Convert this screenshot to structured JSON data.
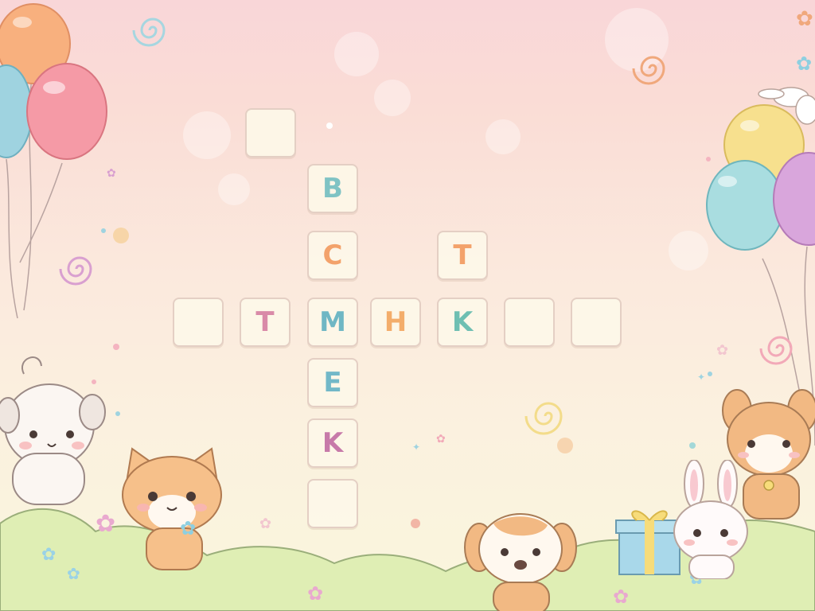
{
  "puzzle": {
    "tiles": [
      {
        "id": "r1c3",
        "letter": "",
        "color": ""
      },
      {
        "id": "r2c3",
        "letter": "B",
        "color": "#7fc3c4"
      },
      {
        "id": "r3c3",
        "letter": "C",
        "color": "#f3a26b"
      },
      {
        "id": "r3c5",
        "letter": "T",
        "color": "#f3a26b"
      },
      {
        "id": "r4c1",
        "letter": "",
        "color": ""
      },
      {
        "id": "r4c2",
        "letter": "T",
        "color": "#d98aa8"
      },
      {
        "id": "r4c3",
        "letter": "M",
        "color": "#6fb7c4"
      },
      {
        "id": "r4c4",
        "letter": "H",
        "color": "#f3ad6b"
      },
      {
        "id": "r4c5",
        "letter": "K",
        "color": "#6fbfb2"
      },
      {
        "id": "r4c6",
        "letter": "",
        "color": ""
      },
      {
        "id": "r4c7",
        "letter": "",
        "color": ""
      },
      {
        "id": "r5c3",
        "letter": "E",
        "color": "#72b8c8"
      },
      {
        "id": "r6c3",
        "letter": "K",
        "color": "#c77aa9"
      },
      {
        "id": "r7c3",
        "letter": "",
        "color": ""
      }
    ]
  },
  "palette": {
    "balloon_orange": "#f8b07e",
    "balloon_pink": "#f59aa6",
    "balloon_blue": "#9fd3e0",
    "balloon_yellow": "#f7e08e",
    "balloon_mint": "#a9dde0",
    "balloon_purple": "#d9a6dc",
    "grass": "#dfeeb4",
    "tile_border": "#e4cfc4"
  }
}
